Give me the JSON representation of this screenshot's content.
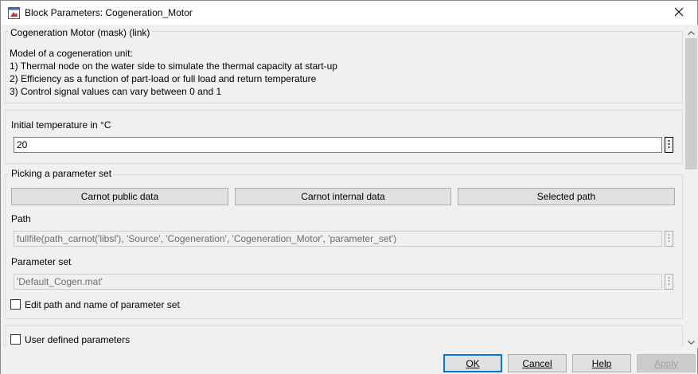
{
  "window": {
    "title": "Block Parameters: Cogeneration_Motor"
  },
  "description": {
    "group_title": "Cogeneration Motor (mask) (link)",
    "lines": [
      "Model of a cogeneration unit:",
      "1) Thermal node on the water side to simulate the thermal capacity at start-up",
      "2) Efficiency as a function of part-load or full load and return temperature",
      "3) Control signal values can vary between 0 and 1"
    ]
  },
  "initial_temperature": {
    "label": "Initial temperature in °C",
    "value": "20"
  },
  "picking": {
    "group_title": "Picking a parameter set",
    "buttons": [
      "Carnot public data",
      "Carnot internal data",
      "Selected path"
    ],
    "path_label": "Path",
    "path_value": "fullfile(path_carnot('libsl'), 'Source', 'Cogeneration', 'Cogeneration_Motor', 'parameter_set')",
    "param_set_label": "Parameter set",
    "param_set_value": "'Default_Cogen.mat'",
    "edit_checkbox_label": "Edit path and name of parameter set",
    "edit_checked": false
  },
  "user_defined": {
    "label": "User defined parameters",
    "checked": false
  },
  "dialog_buttons": {
    "ok": "OK",
    "cancel": "Cancel",
    "help": "Help",
    "apply": "Apply"
  },
  "icons": {
    "app": "block-parameters-icon",
    "close": "close-icon",
    "dots": "ellipsis-vertical-icon",
    "scroll_up": "chevron-up-icon",
    "scroll_down": "chevron-down-icon"
  },
  "colors": {
    "accent": "#0078d7",
    "background": "#f0f0f0",
    "button": "#e1e1e1"
  }
}
